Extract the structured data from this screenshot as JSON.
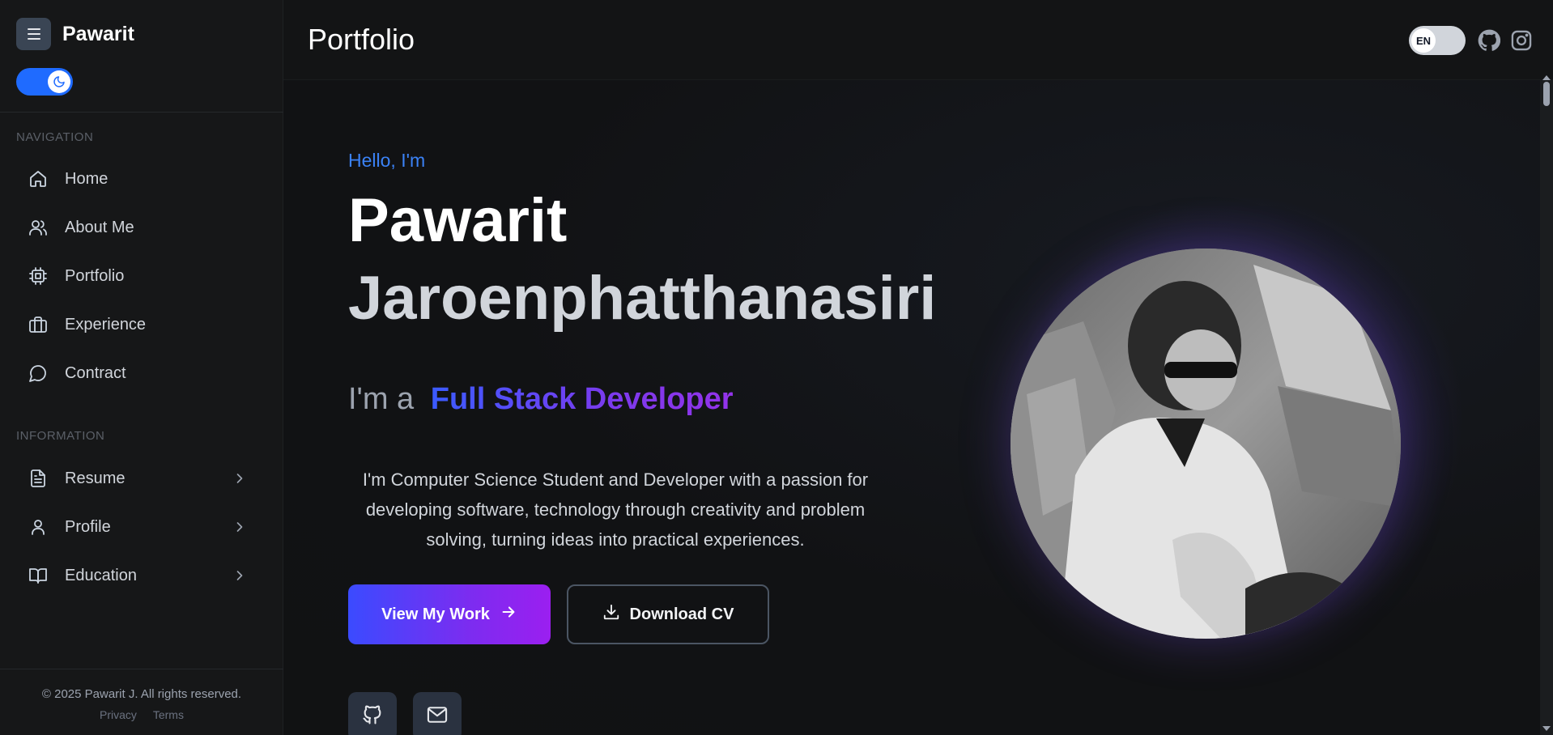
{
  "sidebar": {
    "brand": "Pawarit",
    "sections": {
      "navigation": "NAVIGATION",
      "information": "INFORMATION"
    },
    "nav_items": [
      {
        "label": "Home",
        "icon": "home-icon"
      },
      {
        "label": "About Me",
        "icon": "users-icon"
      },
      {
        "label": "Portfolio",
        "icon": "chip-icon"
      },
      {
        "label": "Experience",
        "icon": "briefcase-icon"
      },
      {
        "label": "Contract",
        "icon": "chat-icon"
      }
    ],
    "info_items": [
      {
        "label": "Resume",
        "icon": "document-icon"
      },
      {
        "label": "Profile",
        "icon": "user-icon"
      },
      {
        "label": "Education",
        "icon": "book-icon"
      }
    ],
    "footer": {
      "copyright": "© 2025 Pawarit J. All rights reserved.",
      "privacy": "Privacy",
      "terms": "Terms"
    }
  },
  "header": {
    "title": "Portfolio",
    "language": "EN"
  },
  "hero": {
    "greeting": "Hello, I'm",
    "first_name": "Pawarit",
    "last_name": "Jaroenphatthanasiri",
    "role_prefix": "I'm a",
    "role": "Full Stack Developer",
    "description": "I'm Computer Science Student and Developer with a passion for developing software, technology through creativity and problem solving, turning ideas into practical experiences.",
    "primary_button": "View My Work",
    "secondary_button": "Download CV"
  },
  "colors": {
    "accent": "#3b82f6",
    "gradient_start": "#3b4bff",
    "gradient_end": "#9b1ff0"
  }
}
